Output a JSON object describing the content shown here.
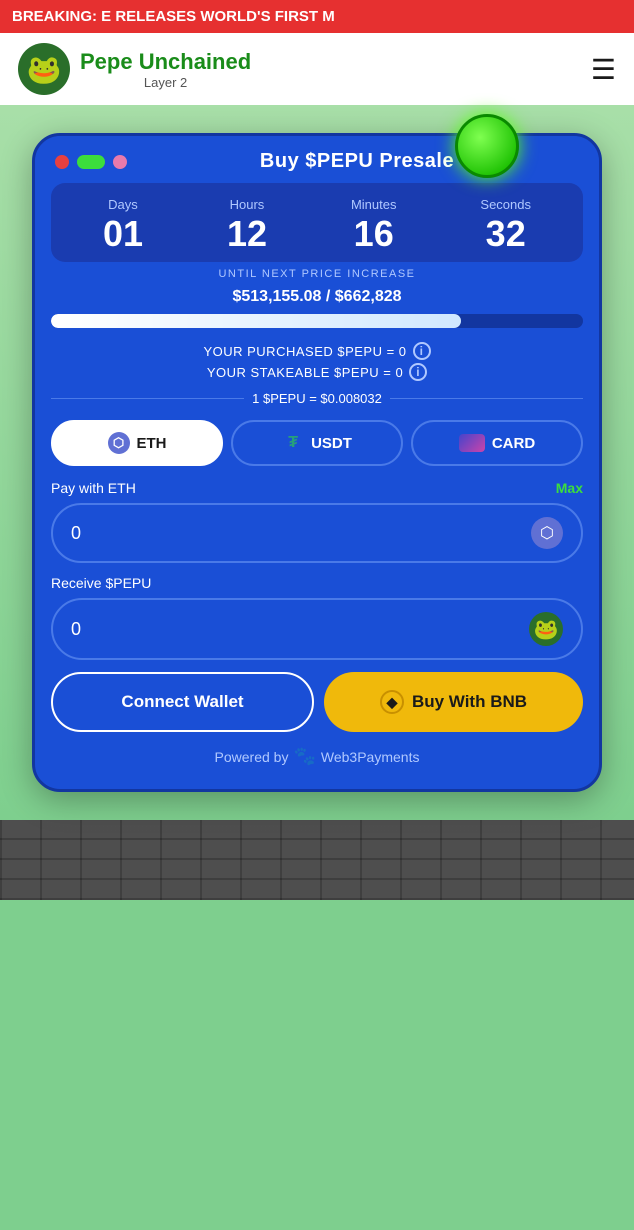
{
  "breaking": {
    "text": "BREAKING:   E RELEASES WORLD'S FIRST M"
  },
  "header": {
    "logo_emoji": "🐸",
    "brand_name": "Pepe Unchained",
    "brand_sub": "Layer 2",
    "menu_label": "☰"
  },
  "widget": {
    "title": "Buy $PEPU Presale",
    "countdown": {
      "days_label": "Days",
      "days_value": "01",
      "hours_label": "Hours",
      "hours_value": "12",
      "minutes_label": "Minutes",
      "minutes_value": "16",
      "seconds_label": "Seconds",
      "seconds_value": "32"
    },
    "until_text": "UNTIL NEXT PRICE INCREASE",
    "progress_amount": "$513,155.08 / $662,828",
    "progress_percent": 77,
    "purchased_label": "YOUR PURCHASED $PEPU = 0",
    "stakeable_label": "YOUR STAKEABLE $PEPU = 0",
    "price_label": "1 $PEPU = $0.008032",
    "currency_buttons": [
      {
        "id": "eth",
        "label": "ETH",
        "active": true
      },
      {
        "id": "usdt",
        "label": "USDT",
        "active": false
      },
      {
        "id": "card",
        "label": "CARD",
        "active": false
      }
    ],
    "pay_label": "Pay with ETH",
    "max_label": "Max",
    "pay_placeholder": "0",
    "receive_label": "Receive $PEPU",
    "receive_placeholder": "0",
    "connect_wallet_label": "Connect Wallet",
    "buy_bnb_label": "Buy With BNB",
    "powered_label": "Powered by",
    "powered_brand": "Web3Payments"
  }
}
